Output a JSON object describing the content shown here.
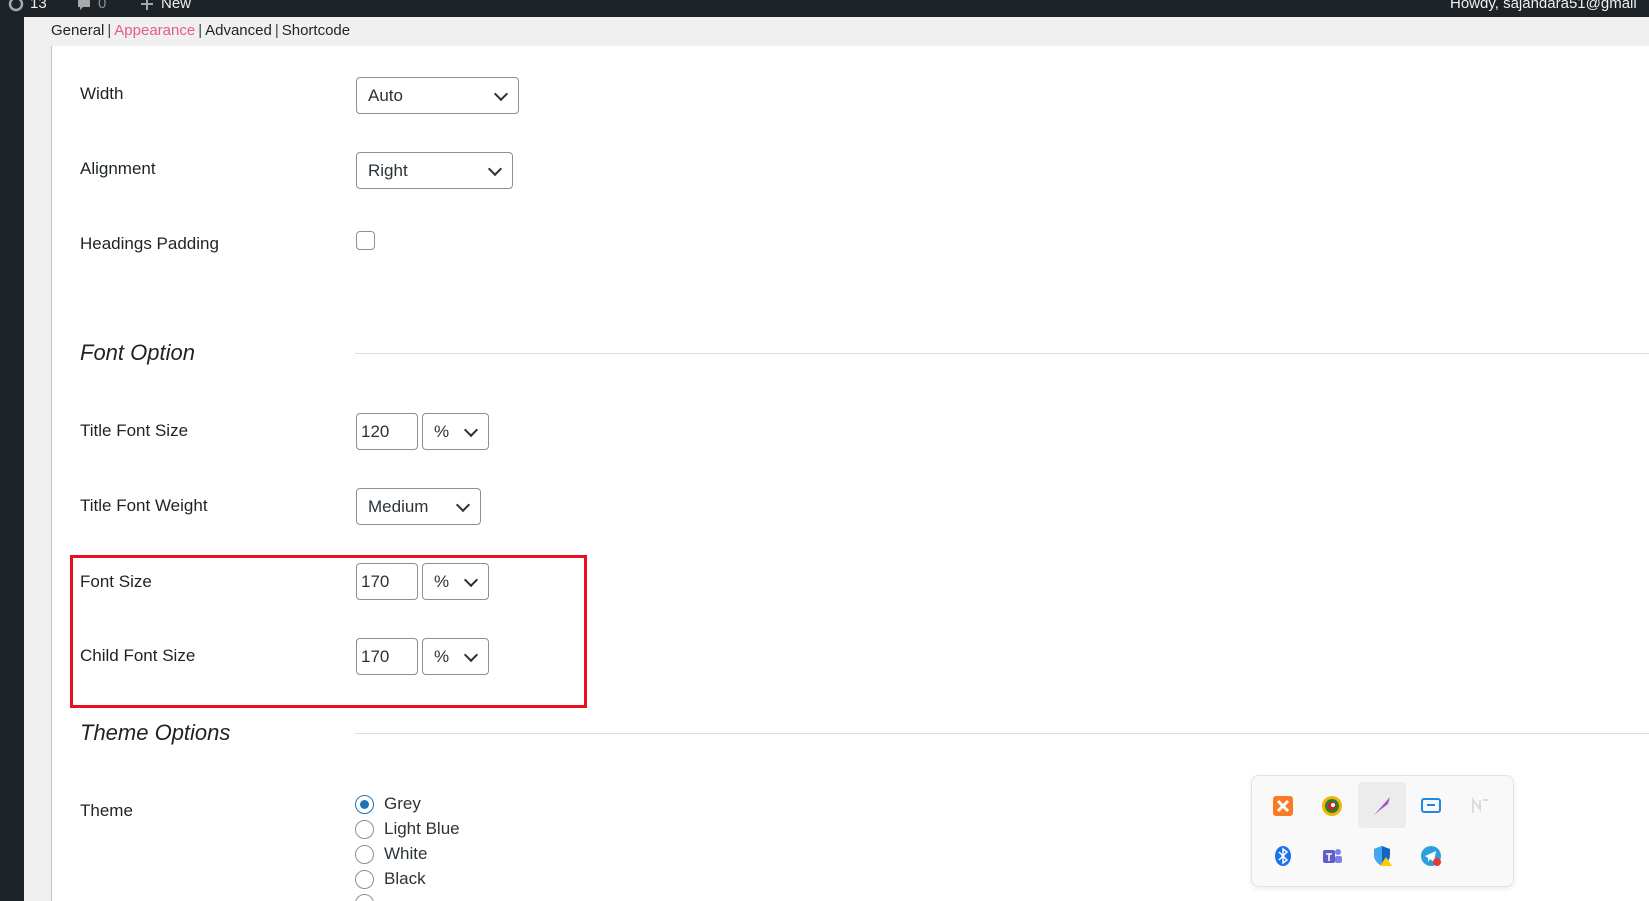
{
  "adminbar": {
    "updates_count": "13",
    "comments_count": "0",
    "new_label": "New",
    "howdy": "Howdy, sajandara51@gmail"
  },
  "subnav": {
    "general": "General",
    "appearance": "Appearance",
    "advanced": "Advanced",
    "shortcode": "Shortcode",
    "separator": "|"
  },
  "fields": {
    "width": {
      "label": "Width",
      "value": "Auto"
    },
    "alignment": {
      "label": "Alignment",
      "value": "Right"
    },
    "headings_padding": {
      "label": "Headings Padding",
      "checked": false
    },
    "font_option_title": "Font Option",
    "title_font_size": {
      "label": "Title Font Size",
      "value": "120",
      "unit": "%"
    },
    "title_font_weight": {
      "label": "Title Font Weight",
      "value": "Medium"
    },
    "font_size": {
      "label": "Font Size",
      "value": "170",
      "unit": "%"
    },
    "child_font_size": {
      "label": "Child Font Size",
      "value": "170",
      "unit": "%"
    },
    "theme_options_title": "Theme Options",
    "theme": {
      "label": "Theme",
      "options": [
        "Grey",
        "Light Blue",
        "White",
        "Black"
      ],
      "selected": "Grey"
    }
  },
  "tray": {
    "icons": [
      "xampp-icon",
      "color-picker-icon",
      "quill-icon",
      "remote-desktop-icon",
      "faded-app-icon",
      "bluetooth-icon",
      "teams-icon",
      "security-warning-icon",
      "telegram-icon"
    ]
  },
  "colors": {
    "accent_link": "#e65a8f",
    "highlight_border": "#e8101f",
    "radio_checked": "#2271b1",
    "adminbar_bg": "#1d2327"
  }
}
